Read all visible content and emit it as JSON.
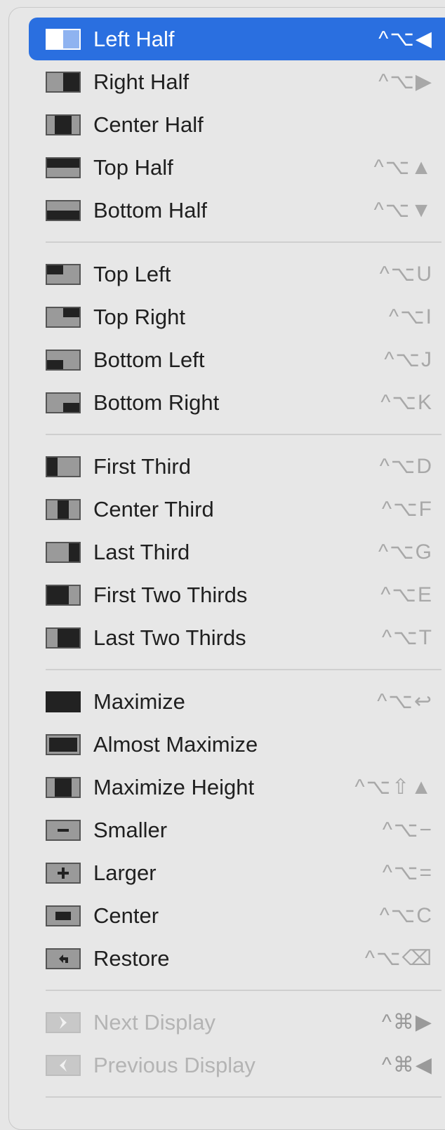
{
  "menu": {
    "sections": [
      [
        {
          "label": "Left Half",
          "shortcut": "^⌥◀",
          "icon": "left-half-icon",
          "selected": true
        },
        {
          "label": "Right Half",
          "shortcut": "^⌥▶",
          "icon": "right-half-icon"
        },
        {
          "label": "Center Half",
          "shortcut": "",
          "icon": "center-half-icon"
        },
        {
          "label": "Top Half",
          "shortcut": "^⌥▲",
          "icon": "top-half-icon"
        },
        {
          "label": "Bottom Half",
          "shortcut": "^⌥▼",
          "icon": "bottom-half-icon"
        }
      ],
      [
        {
          "label": "Top Left",
          "shortcut": "^⌥U",
          "icon": "top-left-icon"
        },
        {
          "label": "Top Right",
          "shortcut": "^⌥I",
          "icon": "top-right-icon"
        },
        {
          "label": "Bottom Left",
          "shortcut": "^⌥J",
          "icon": "bottom-left-icon"
        },
        {
          "label": "Bottom Right",
          "shortcut": "^⌥K",
          "icon": "bottom-right-icon"
        }
      ],
      [
        {
          "label": "First Third",
          "shortcut": "^⌥D",
          "icon": "first-third-icon"
        },
        {
          "label": "Center Third",
          "shortcut": "^⌥F",
          "icon": "center-third-icon"
        },
        {
          "label": "Last Third",
          "shortcut": "^⌥G",
          "icon": "last-third-icon"
        },
        {
          "label": "First Two Thirds",
          "shortcut": "^⌥E",
          "icon": "first-two-thirds-icon"
        },
        {
          "label": "Last Two Thirds",
          "shortcut": "^⌥T",
          "icon": "last-two-thirds-icon"
        }
      ],
      [
        {
          "label": "Maximize",
          "shortcut": "^⌥↩",
          "icon": "maximize-icon"
        },
        {
          "label": "Almost Maximize",
          "shortcut": "",
          "icon": "almost-maximize-icon"
        },
        {
          "label": "Maximize Height",
          "shortcut": "^⌥⇧▲",
          "icon": "maximize-height-icon"
        },
        {
          "label": "Smaller",
          "shortcut": "^⌥−",
          "icon": "smaller-icon"
        },
        {
          "label": "Larger",
          "shortcut": "^⌥=",
          "icon": "larger-icon"
        },
        {
          "label": "Center",
          "shortcut": "^⌥C",
          "icon": "center-icon"
        },
        {
          "label": "Restore",
          "shortcut": "^⌥⌫",
          "icon": "restore-icon"
        }
      ],
      [
        {
          "label": "Next Display",
          "shortcut": "^⌘▶",
          "icon": "next-display-icon",
          "disabled": true
        },
        {
          "label": "Previous Display",
          "shortcut": "^⌘◀",
          "icon": "previous-display-icon",
          "disabled": true
        }
      ]
    ]
  },
  "colors": {
    "selection": "#2a6fe0",
    "menu_background": "#e7e7e7",
    "text": "#1f1f1f",
    "shortcut_text": "#a8a8a8",
    "disabled_text": "#b4b4b4"
  }
}
